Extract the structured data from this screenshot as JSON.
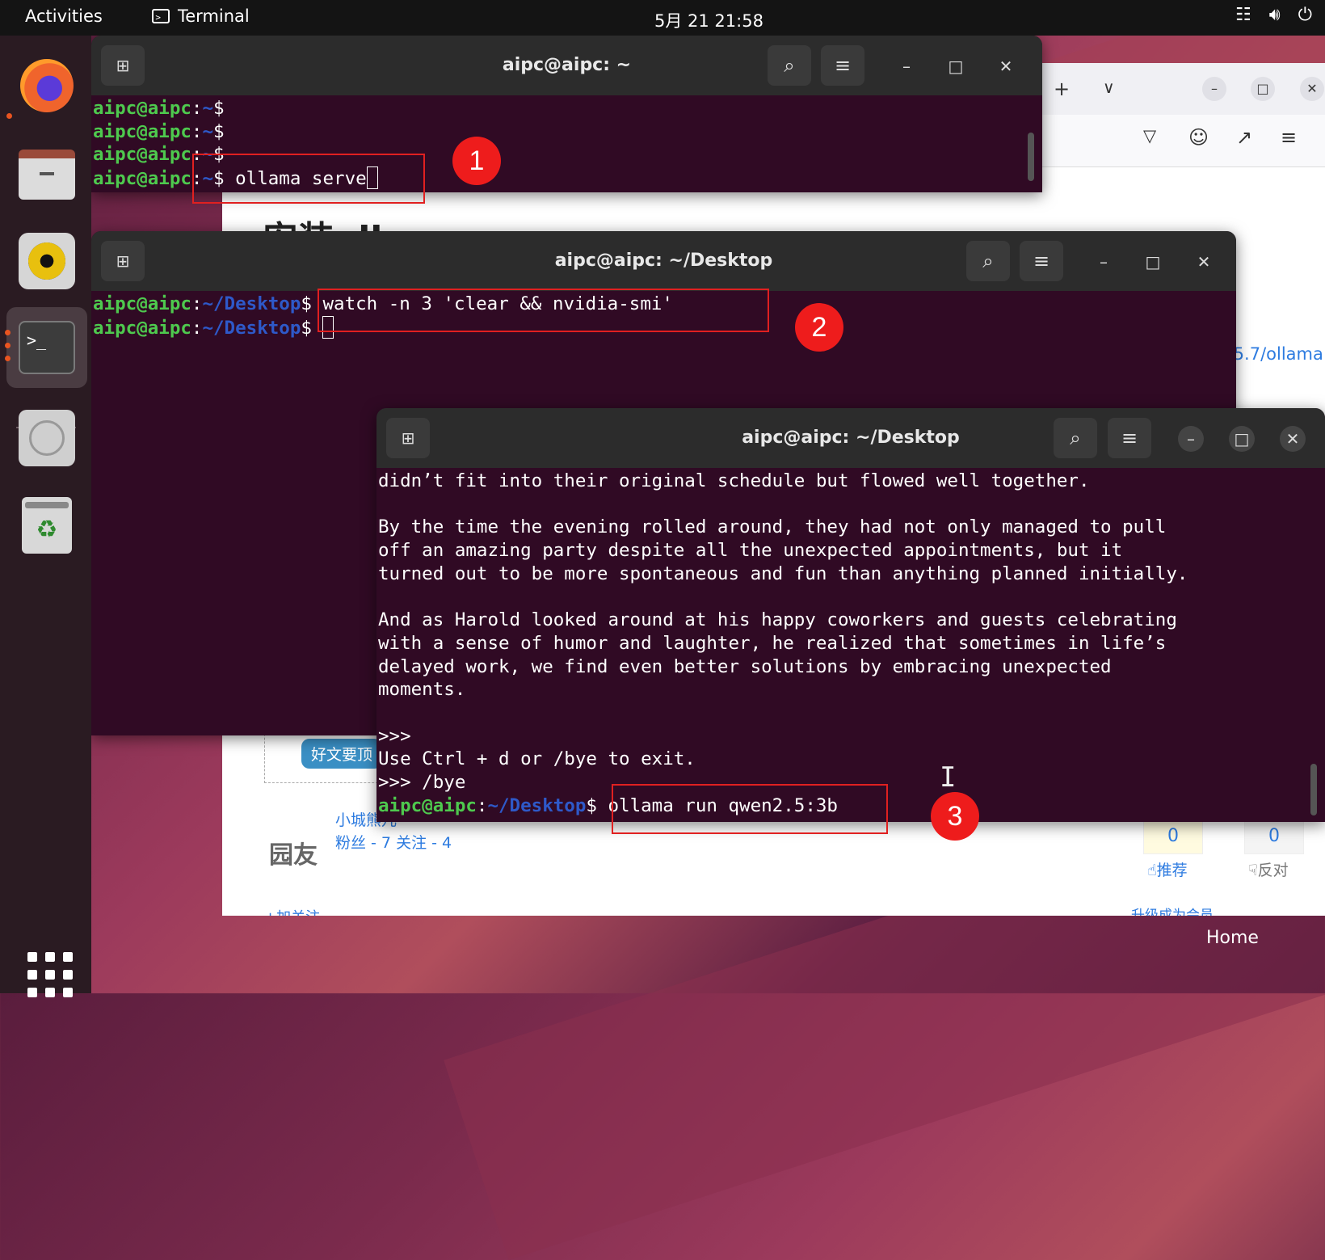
{
  "topbar": {
    "activities": "Activities",
    "app_name": "Terminal",
    "clock": "5月 21  21:58",
    "icons": [
      "network-icon",
      "volume-icon",
      "power-icon"
    ]
  },
  "dock": {
    "items": [
      "firefox-icon",
      "files-icon",
      "rhythmbox-icon",
      "terminal-icon",
      "disc-icon",
      "trash-icon",
      "apps-grid-icon"
    ]
  },
  "browser": {
    "heading_peek": "安装ollama",
    "link_peek": ".5.7/ollama",
    "tag_label": "好文要顶",
    "author_name": "小城熊儿",
    "author_stats": "粉丝 - 7 关注 - 4",
    "avatar_text": "园友",
    "follow": "+加关注",
    "recommend_count": "0",
    "recommend_label": "推荐",
    "oppose_count": "0",
    "oppose_label": "反对",
    "upgrade": "升级成为会员"
  },
  "desktop": {
    "home_label": "Home"
  },
  "term1": {
    "title": "aipc@aipc: ~",
    "prompt_user": "aipc@aipc",
    "prompt_path": "~",
    "command": " ollama serve"
  },
  "term2": {
    "title": "aipc@aipc: ~/Desktop",
    "prompt_user": "aipc@aipc",
    "prompt_path": "~/Desktop",
    "command": " watch -n 3 'clear && nvidia-smi'"
  },
  "term3": {
    "title": "aipc@aipc: ~/Desktop",
    "lines": [
      "didn’t fit into their original schedule but flowed well together.",
      "",
      "By the time the evening rolled around, they had not only managed to pull",
      "off an amazing party despite all the unexpected appointments, but it",
      "turned out to be more spontaneous and fun than anything planned initially.",
      "",
      "And as Harold looked around at his happy coworkers and guests celebrating",
      "with a sense of humor and laughter, he realized that sometimes in life’s",
      "delayed work, we find even better solutions by embracing unexpected",
      "moments.",
      "",
      ">>>",
      "Use Ctrl + d or /bye to exit.",
      ">>> /bye"
    ],
    "prompt_user": "aipc@aipc",
    "prompt_path": "~/Desktop",
    "command": " ollama run qwen2.5:3b"
  },
  "annotations": [
    "1",
    "2",
    "3"
  ]
}
